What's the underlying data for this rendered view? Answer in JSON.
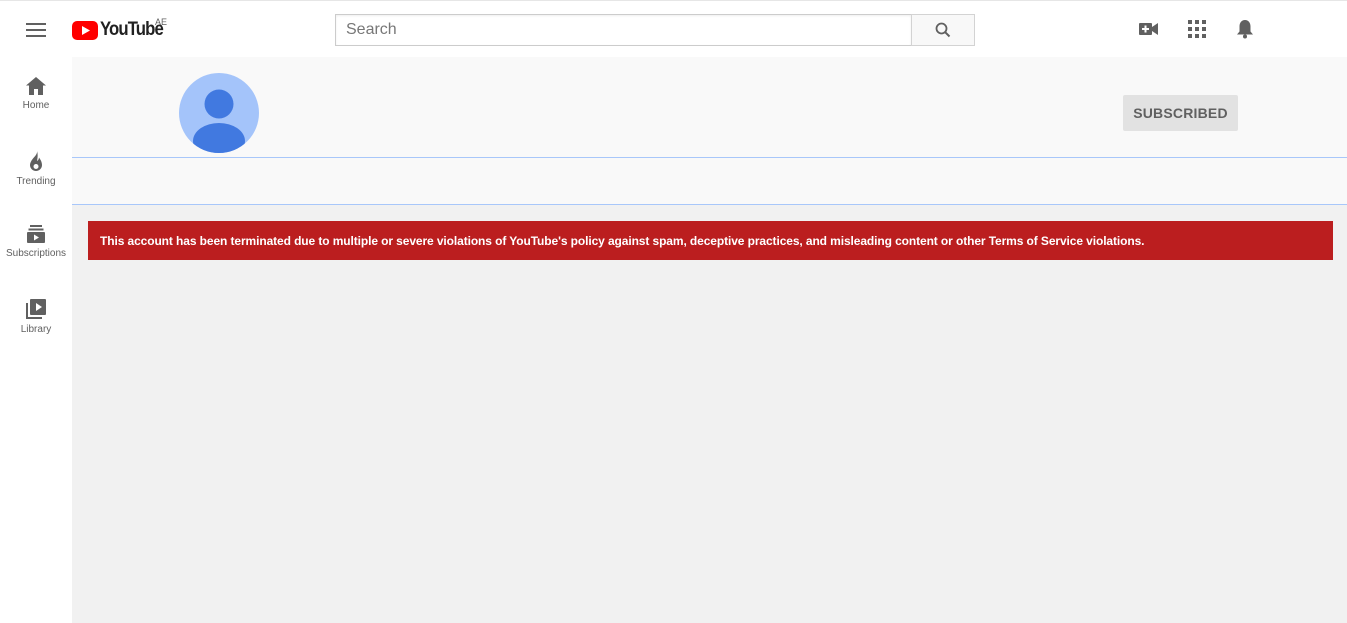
{
  "header": {
    "logo_text": "YouTube",
    "country_code": "AE",
    "search": {
      "placeholder": "Search"
    },
    "icons": [
      "menu-icon",
      "search-icon",
      "video-camera-add-icon",
      "apps-grid-icon",
      "bell-icon"
    ]
  },
  "sidebar": {
    "items": [
      {
        "label": "Home",
        "icon": "home-icon"
      },
      {
        "label": "Trending",
        "icon": "flame-icon"
      },
      {
        "label": "Subscriptions",
        "icon": "subscriptions-icon"
      },
      {
        "label": "Library",
        "icon": "library-icon"
      }
    ]
  },
  "channel": {
    "avatar_icon": "default-avatar-icon",
    "subscribe_button_label": "SUBSCRIBED"
  },
  "alert": {
    "message": "This account has been terminated due to multiple or severe violations of YouTube's policy against spam, deceptive practices, and misleading content or other Terms of Service violations."
  },
  "colors": {
    "brand_red": "#ff0000",
    "alert_background": "#bb1e1f",
    "avatar_background": "#a4c4fa",
    "avatar_figure": "#4179e0",
    "main_background": "#f1f1f1"
  }
}
